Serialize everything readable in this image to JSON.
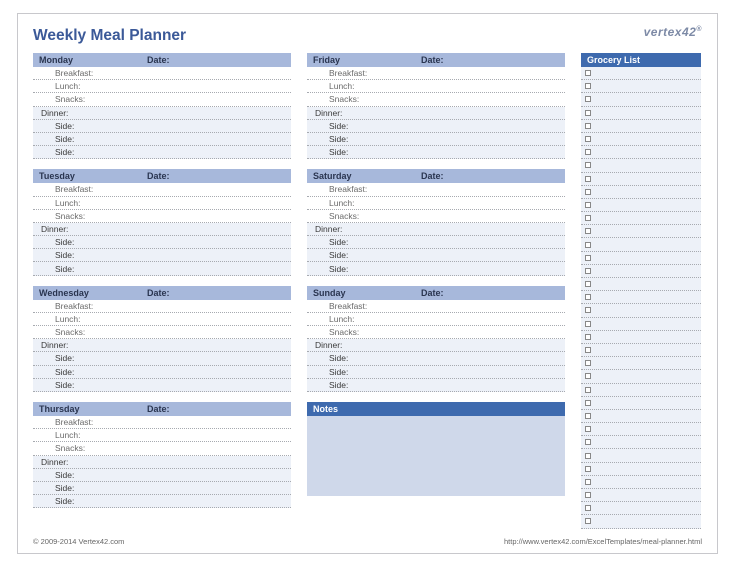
{
  "header": {
    "title": "Weekly Meal Planner",
    "logo": "vertex42",
    "logo_suffix": "®"
  },
  "labels": {
    "date": "Date:",
    "notes": "Notes",
    "grocery": "Grocery List"
  },
  "meals": {
    "breakfast": "Breakfast:",
    "lunch": "Lunch:",
    "snacks": "Snacks:",
    "dinner": "Dinner:",
    "side": "Side:"
  },
  "days": {
    "mon": "Monday",
    "tue": "Tuesday",
    "wed": "Wednesday",
    "thu": "Thursday",
    "fri": "Friday",
    "sat": "Saturday",
    "sun": "Sunday"
  },
  "grocery_count": 35,
  "footer": {
    "copyright": "© 2009-2014 Vertex42.com",
    "url": "http://www.vertex42.com/ExcelTemplates/meal-planner.html"
  }
}
